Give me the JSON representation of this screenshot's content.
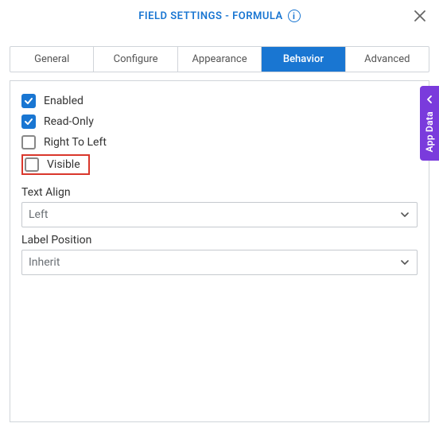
{
  "header": {
    "title": "FIELD SETTINGS - FORMULA"
  },
  "tabs": {
    "items": [
      {
        "label": "General"
      },
      {
        "label": "Configure"
      },
      {
        "label": "Appearance"
      },
      {
        "label": "Behavior"
      },
      {
        "label": "Advanced"
      }
    ]
  },
  "behavior": {
    "checkboxes": {
      "enabled": {
        "label": "Enabled"
      },
      "readonly": {
        "label": "Read-Only"
      },
      "rtl": {
        "label": "Right To Left"
      },
      "visible": {
        "label": "Visible"
      }
    },
    "text_align": {
      "label": "Text Align",
      "value": "Left"
    },
    "label_position": {
      "label": "Label Position",
      "value": "Inherit"
    }
  },
  "side": {
    "label": "App Data"
  }
}
